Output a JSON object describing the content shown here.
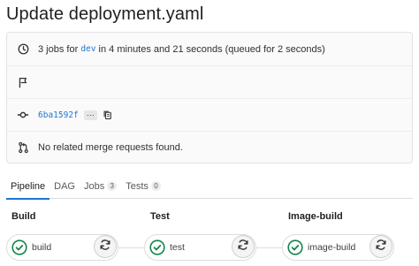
{
  "header": {
    "title": "Update deployment.yaml"
  },
  "summary": {
    "jobs_prefix": "3 jobs for",
    "branch": "dev",
    "jobs_suffix": "in 4 minutes and 21 seconds (queued for 2 seconds)",
    "commit_sha": "6ba1592f",
    "ellipsis": "···",
    "merge_requests_text": "No related merge requests found."
  },
  "tabs": [
    {
      "label": "Pipeline",
      "active": true
    },
    {
      "label": "DAG"
    },
    {
      "label": "Jobs",
      "count": "3"
    },
    {
      "label": "Tests",
      "count": "0"
    }
  ],
  "stages": [
    {
      "title": "Build",
      "jobs": [
        {
          "name": "build",
          "status": "success"
        }
      ]
    },
    {
      "title": "Test",
      "jobs": [
        {
          "name": "test",
          "status": "success"
        }
      ]
    },
    {
      "title": "Image-build",
      "jobs": [
        {
          "name": "image-build",
          "status": "success"
        }
      ]
    }
  ],
  "colors": {
    "success": "#108548",
    "link": "#1f75cb",
    "tab_active": "#1f75cb"
  },
  "icons": [
    "clock-icon",
    "flag-icon",
    "commit-icon",
    "copy-icon",
    "merge-request-icon",
    "status-success-icon",
    "retry-icon"
  ]
}
